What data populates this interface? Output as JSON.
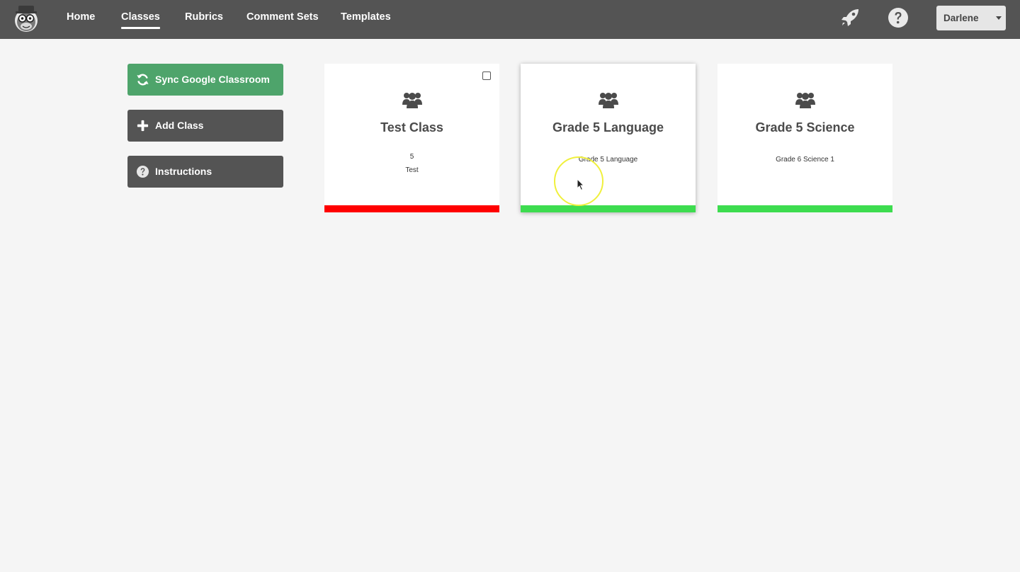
{
  "nav": {
    "links": [
      {
        "label": "Home",
        "active": false
      },
      {
        "label": "Classes",
        "active": true
      },
      {
        "label": "Rubrics",
        "active": false
      },
      {
        "label": "Comment Sets",
        "active": false
      },
      {
        "label": "Templates",
        "active": false
      }
    ],
    "user": {
      "name": "Darlene"
    },
    "icons": [
      "rocket-icon",
      "help-icon"
    ]
  },
  "sidebar": {
    "sync_label": "Sync Google Classroom",
    "add_label": "Add Class",
    "instructions_label": "Instructions"
  },
  "cards": [
    {
      "title": "Test Class",
      "line1": "5",
      "line2": "Test",
      "status_color": "#ff0000",
      "checkbox": true
    },
    {
      "title": "Grade 5 Language",
      "line1": "Grade 5 Language",
      "status_color": "#3ddc4f"
    },
    {
      "title": "Grade 5 Science",
      "line1": "Grade 6 Science 1",
      "status_color": "#3ddc4f"
    }
  ],
  "colors": {
    "topbar": "#545454",
    "green_button": "#4ea46b",
    "dark_button": "#545454",
    "background": "#f5f5f5"
  }
}
